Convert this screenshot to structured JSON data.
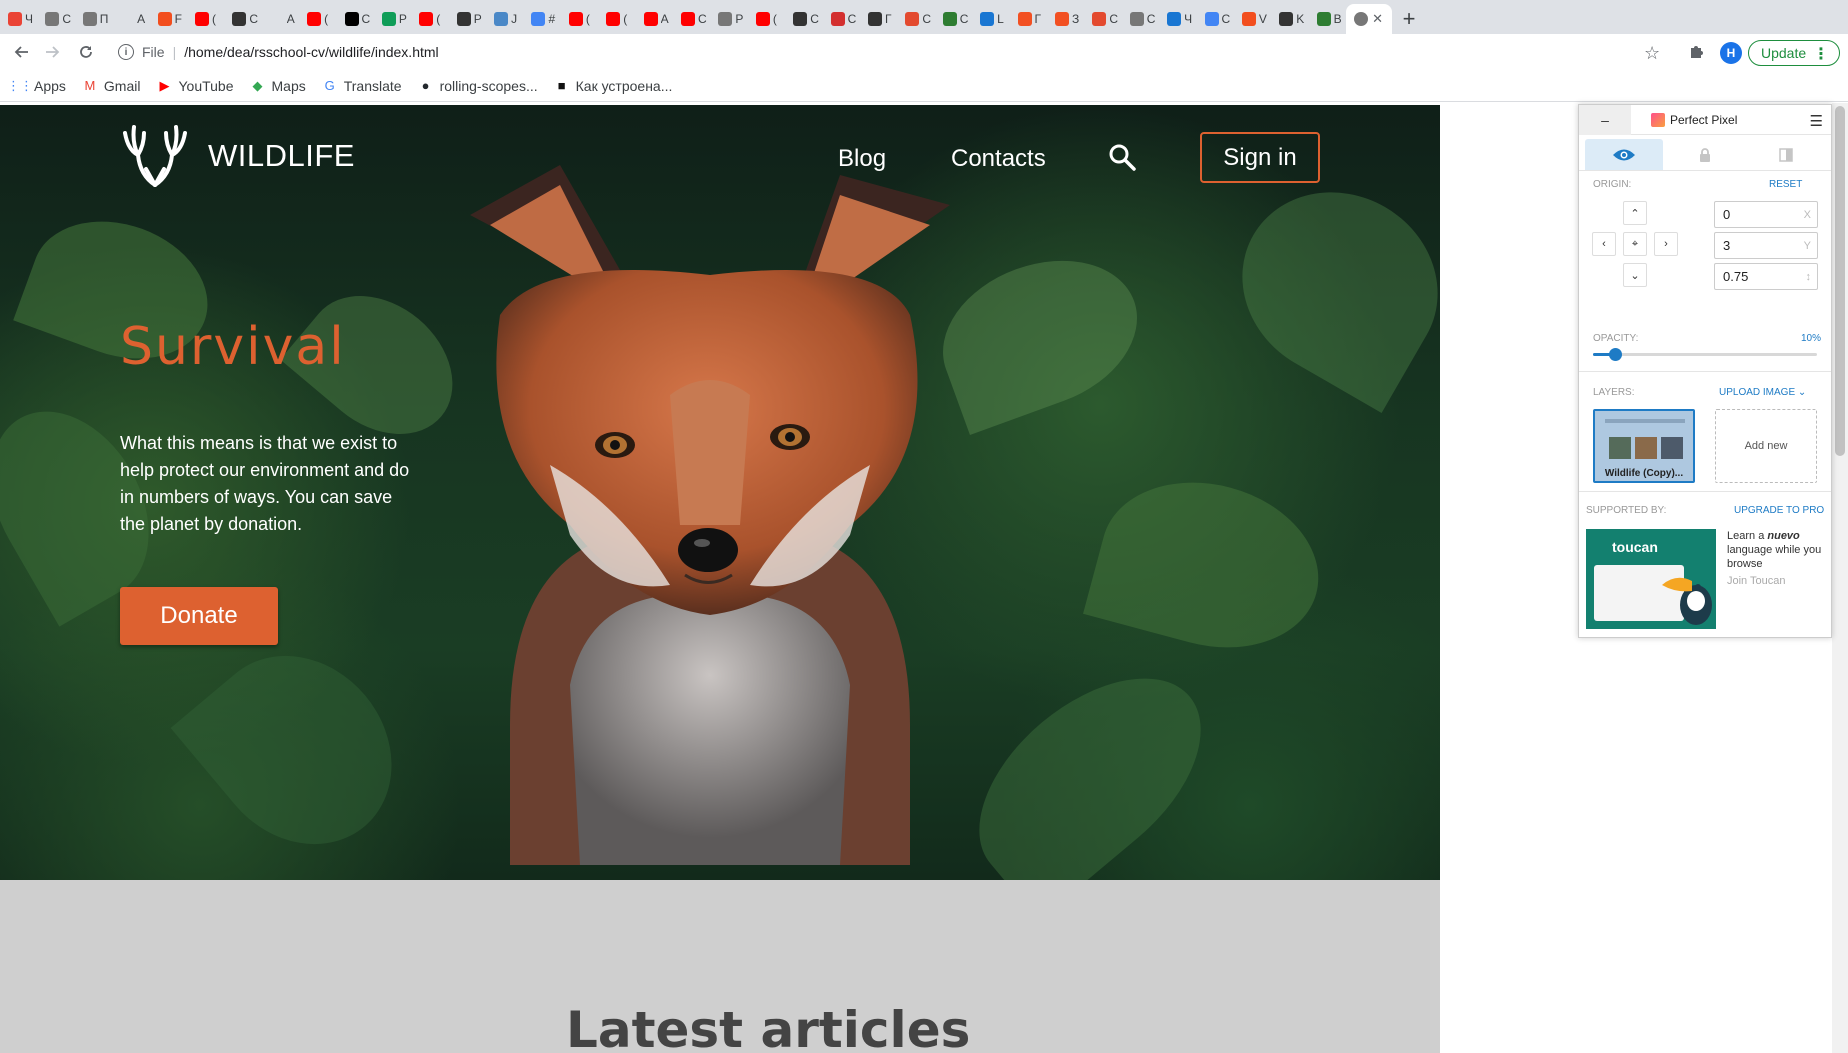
{
  "browser": {
    "tabs": [
      {
        "title": "Ч",
        "color": "#ea4335"
      },
      {
        "title": "C",
        "color": "#777"
      },
      {
        "title": "П",
        "color": "#777"
      },
      {
        "title": "A",
        "color": "#dee1e6"
      },
      {
        "title": "F",
        "color": "#f24e1e"
      },
      {
        "title": "(",
        "color": "#ff0000"
      },
      {
        "title": "C",
        "color": "#333"
      },
      {
        "title": "A",
        "color": "#dee1e6"
      },
      {
        "title": "(",
        "color": "#ff0000"
      },
      {
        "title": "C",
        "color": "#000"
      },
      {
        "title": "P",
        "color": "#0f9d58"
      },
      {
        "title": "(",
        "color": "#ff0000"
      },
      {
        "title": "P",
        "color": "#333"
      },
      {
        "title": "J",
        "color": "#4a88c7"
      },
      {
        "title": "#",
        "color": "#4285f4"
      },
      {
        "title": "(",
        "color": "#ff0000"
      },
      {
        "title": "(",
        "color": "#ff0000"
      },
      {
        "title": "A",
        "color": "#ff0000"
      },
      {
        "title": "C",
        "color": "#ff0000"
      },
      {
        "title": "P",
        "color": "#777"
      },
      {
        "title": "(",
        "color": "#ff0000"
      },
      {
        "title": "C",
        "color": "#333"
      },
      {
        "title": "C",
        "color": "#d32f2f"
      },
      {
        "title": "Г",
        "color": "#333"
      },
      {
        "title": "C",
        "color": "#e34a2f"
      },
      {
        "title": "C",
        "color": "#2e7d32"
      },
      {
        "title": "L",
        "color": "#1976d2"
      },
      {
        "title": "Г",
        "color": "#f25022"
      },
      {
        "title": "З",
        "color": "#f25022"
      },
      {
        "title": "C",
        "color": "#e34a2f"
      },
      {
        "title": "C",
        "color": "#777"
      },
      {
        "title": "Ч",
        "color": "#1976d2"
      },
      {
        "title": "C",
        "color": "#4285f4"
      },
      {
        "title": "V",
        "color": "#f24e1e"
      },
      {
        "title": "K",
        "color": "#333"
      },
      {
        "title": "B",
        "color": "#2e7d32"
      }
    ],
    "active_tab": {
      "title": "",
      "color": "#777"
    },
    "new_tab": "+",
    "close_glyph": "✕",
    "address": {
      "scheme": "File",
      "url": "/home/dea/rsschool-cv/wildlife/index.html"
    },
    "profile_initial": "H",
    "update_label": "Update",
    "bookmarks": [
      {
        "label": "Apps",
        "icon": "apps-grid-icon"
      },
      {
        "label": "Gmail",
        "icon": "gmail-icon"
      },
      {
        "label": "YouTube",
        "icon": "youtube-icon"
      },
      {
        "label": "Maps",
        "icon": "maps-icon"
      },
      {
        "label": "Translate",
        "icon": "translate-icon"
      },
      {
        "label": "rolling-scopes...",
        "icon": "github-icon"
      },
      {
        "label": "Как устроена...",
        "icon": "video-icon"
      }
    ]
  },
  "site": {
    "logo_text": "WILDLIFE",
    "nav": {
      "blog": "Blog",
      "contacts": "Contacts",
      "signin": "Sign in"
    },
    "hero": {
      "title": "Survival",
      "text": "What this means is that we exist to help protect our environment and do in numbers of ways. You can save the planet by donation.",
      "donate": "Donate"
    },
    "latest_heading": "Latest articles",
    "accent_color": "#dd6130"
  },
  "perfect_pixel": {
    "title": "Perfect Pixel",
    "minimize": "–",
    "origin_label": "ORIGIN:",
    "reset": "RESET",
    "x_value": "0",
    "x_suffix": "X",
    "y_value": "3",
    "y_suffix": "Y",
    "scale_value": "0.75",
    "scale_suffix": "↕",
    "opacity_label": "OPACITY:",
    "opacity_value": "10%",
    "opacity_fraction": 0.1,
    "layers_label": "LAYERS:",
    "upload_image": "UPLOAD IMAGE",
    "layer_name": "Wildlife (Copy)...",
    "add_new": "Add new",
    "supported_by": "SUPPORTED BY:",
    "upgrade": "UPGRADE TO PRO",
    "ad_brand": "toucan",
    "ad_text_1": "Learn a",
    "ad_text_em": "nuevo",
    "ad_text_2": "language while you browse",
    "ad_join": "Join Toucan"
  }
}
